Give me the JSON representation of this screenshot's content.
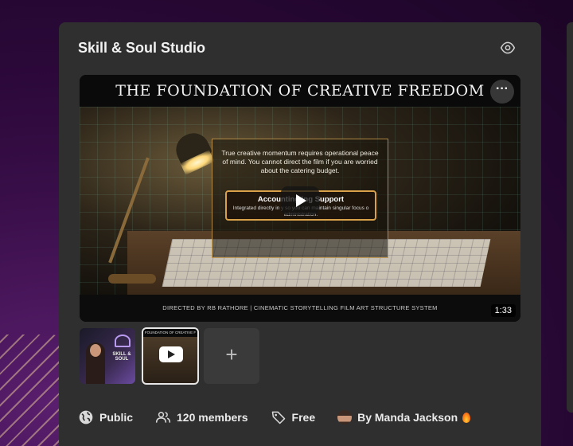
{
  "group": {
    "title": "Skill & Soul Studio"
  },
  "video": {
    "heading": "THE FOUNDATION OF CREATIVE FREEDOM",
    "panel_text": "True creative momentum requires operational peace of mind. You cannot direct the film if you are worried about the catering budget.",
    "accounting_title": "Accounting          ing Support",
    "accounting_sub": "Integrated directly in              y so you can maintain singular focus o                 administration.",
    "credits": "DIRECTED BY RB RATHORE  |  CINEMATIC STORYTELLING FILM ART STRUCTURE SYSTEM",
    "duration": "1:33",
    "more_label": "···"
  },
  "thumbnails": {
    "thumb1_text": "SKILL & SOUL",
    "thumb2_text": "FOUNDATION OF CREATIVE F",
    "add_label": "+"
  },
  "meta": {
    "visibility": "Public",
    "members": "120 members",
    "price": "Free",
    "author": "By Manda Jackson"
  },
  "icons": {
    "visibility_icon": "globe-icon",
    "members_icon": "users-icon",
    "price_icon": "tag-icon",
    "preview_icon": "eye-icon"
  }
}
